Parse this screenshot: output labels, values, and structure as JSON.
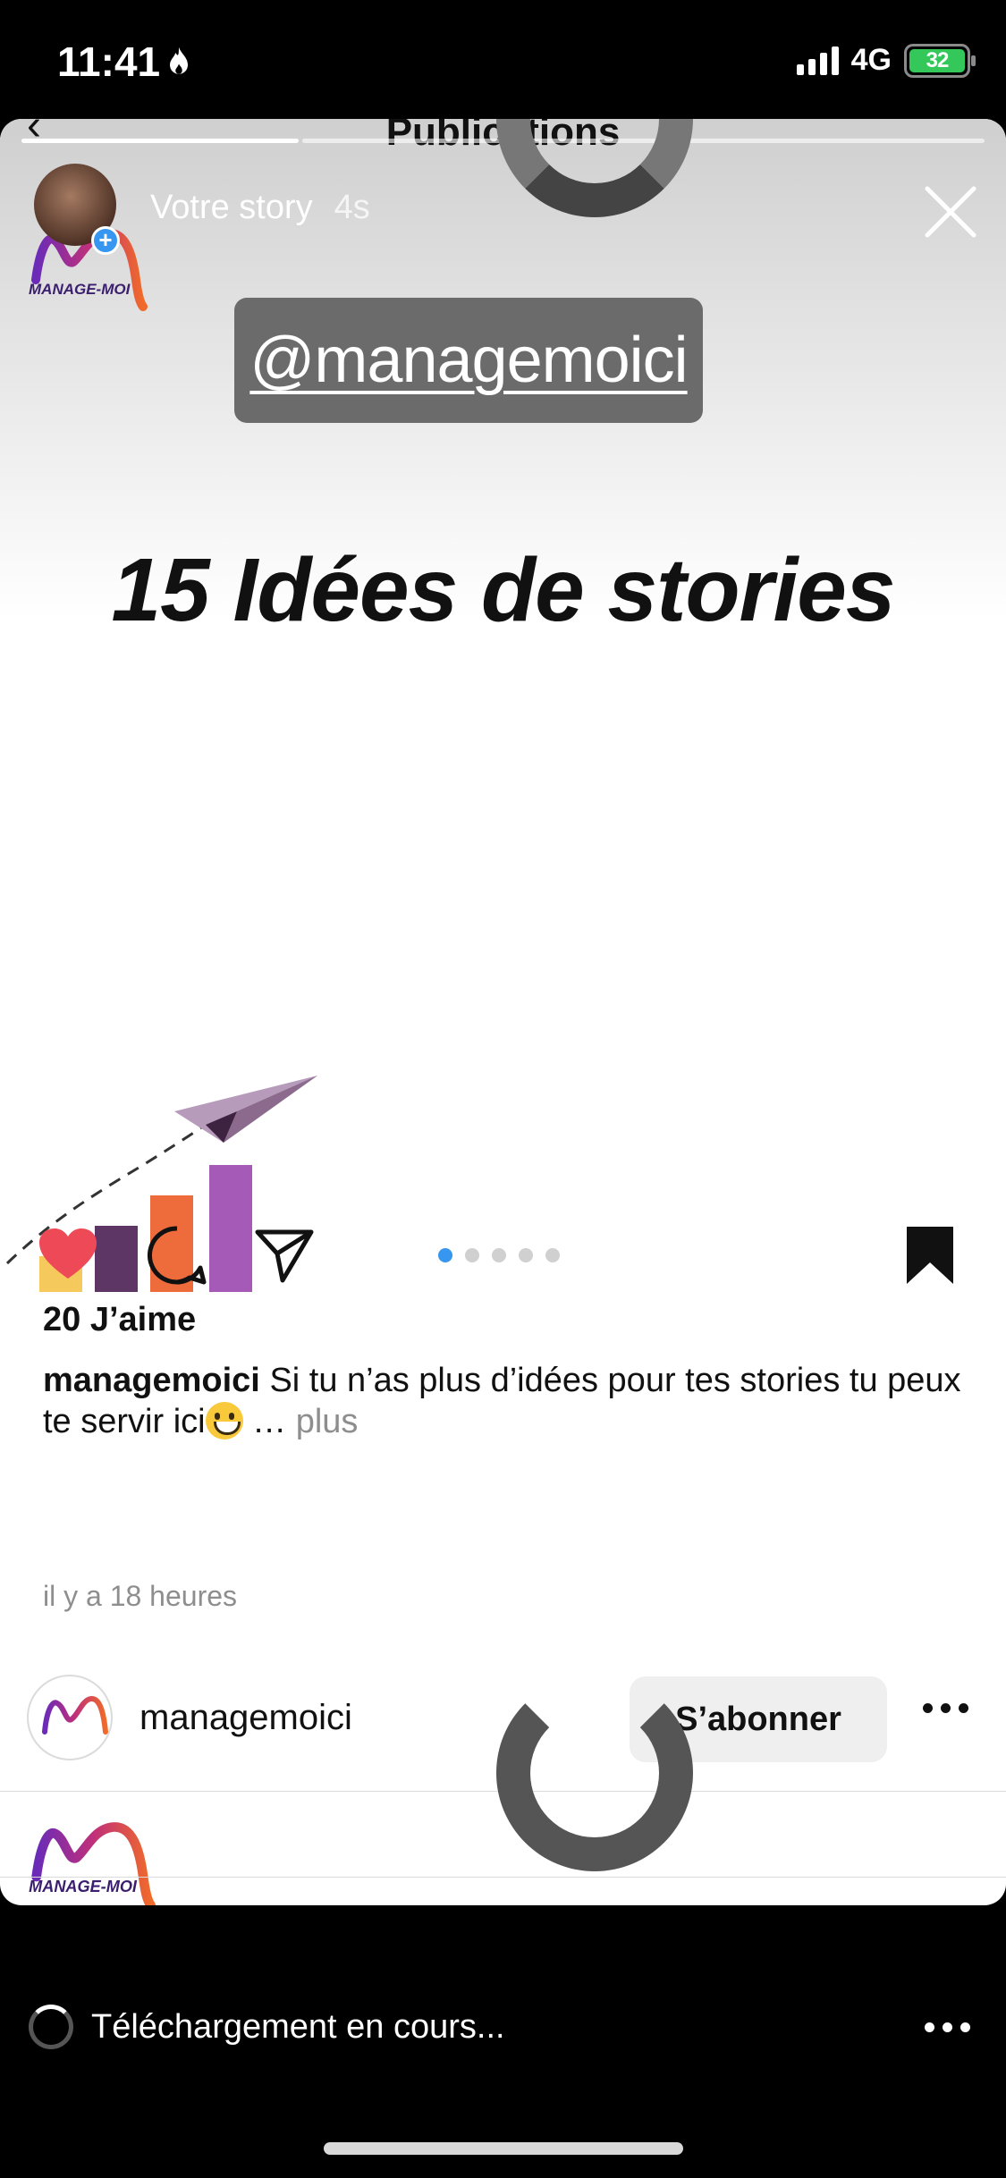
{
  "status_bar": {
    "time": "11:41",
    "network": "4G",
    "battery": "32"
  },
  "header": {
    "title": "Publications"
  },
  "story": {
    "label": "Votre story",
    "age": "4s",
    "mention": "@managemoici",
    "headline": "15 Idées de stories",
    "brand_logo_text": "MANAGE-MOI"
  },
  "post": {
    "likes": "20 J’aime",
    "username": "managemoici",
    "caption": "Si tu n’as plus d’idées pour tes stories tu peux te servir ici",
    "caption_more_prefix": " … ",
    "caption_more": "plus",
    "time_ago": "il y a 18 heures",
    "carousel_count": 5,
    "carousel_active": 0
  },
  "next_post": {
    "username": "managemoici",
    "follow_label": "S’abonner"
  },
  "footer": {
    "download_status": "Téléchargement en cours..."
  },
  "colors": {
    "like_red": "#ed4956",
    "accent_blue": "#3797f0",
    "bar_yellow": "#f5c95b",
    "bar_plum": "#5e3665",
    "bar_orange": "#ee6b3b",
    "bar_purple": "#a55ab8"
  }
}
